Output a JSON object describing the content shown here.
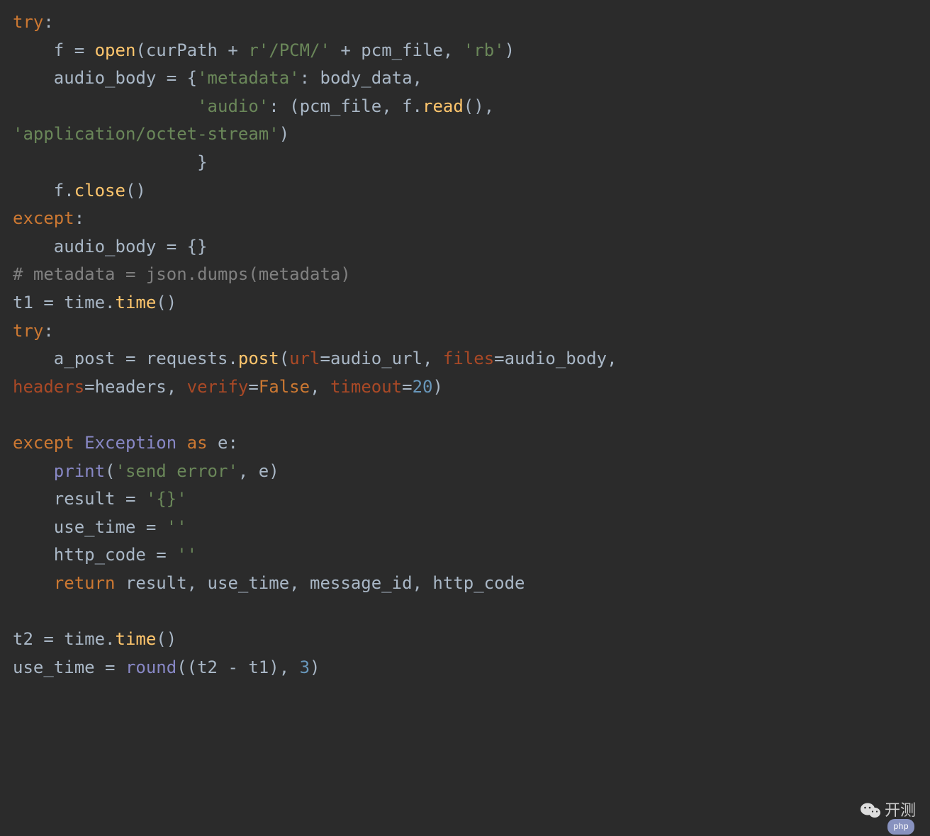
{
  "code": {
    "l1": {
      "try": "try",
      "colon": ":"
    },
    "l2": {
      "f": "f = ",
      "open": "open",
      "p1": "(curPath + ",
      "r": "r",
      "s1": "'/PCM/'",
      "plus": " + pcm_file, ",
      "s2": "'rb'",
      "p2": ")"
    },
    "l3": {
      "a": "audio_body = {",
      "k1": "'metadata'",
      "c": ": body_data,"
    },
    "l4": {
      "k2": "'audio'",
      "c": ": (pcm_file, f.",
      "read": "read",
      "p": "(),"
    },
    "l5": {
      "s": "'application/octet-stream'",
      "p": ")"
    },
    "l6": {
      "brace": "}"
    },
    "l7": {
      "f": "f.",
      "close": "close",
      "p": "()"
    },
    "l8": {
      "except": "except",
      "colon": ":"
    },
    "l9": {
      "a": "audio_body = {}"
    },
    "l10": {
      "cmt": "# metadata = json.dumps(metadata)"
    },
    "l11": {
      "a": "t1 = time.",
      "time": "time",
      "p": "()"
    },
    "l12": {
      "try": "try",
      "colon": ":"
    },
    "l13": {
      "a": "a_post = requests.",
      "post": "post",
      "p1": "(",
      "url": "url",
      "eq1": "=audio_url, ",
      "files": "files",
      "eq2": "=audio_body, "
    },
    "l14": {
      "headers": "headers",
      "eq1": "=headers, ",
      "verify": "verify",
      "eq2": "=",
      "false": "False",
      "c": ", ",
      "timeout": "timeout",
      "eq3": "=",
      "n": "20",
      "p": ")"
    },
    "l15": {
      "except": "except",
      "sp": " ",
      "exc": "Exception",
      "as": " as ",
      "e": "e:"
    },
    "l16": {
      "print": "print",
      "p1": "(",
      "s": "'send error'",
      "c": ", e)"
    },
    "l17": {
      "a": "result = ",
      "s": "'{}'"
    },
    "l18": {
      "a": "use_time = ",
      "s": "''"
    },
    "l19": {
      "a": "http_code = ",
      "s": "''"
    },
    "l20": {
      "ret": "return",
      "a": " result, use_time, message_id, http_code"
    },
    "l21": {
      "a": "t2 = time.",
      "time": "time",
      "p": "()"
    },
    "l22": {
      "a": "use_time = ",
      "round": "round",
      "p1": "((t2 - t1), ",
      "n": "3",
      "p2": ")"
    }
  },
  "watermark": {
    "text": "开测",
    "php": "php"
  }
}
